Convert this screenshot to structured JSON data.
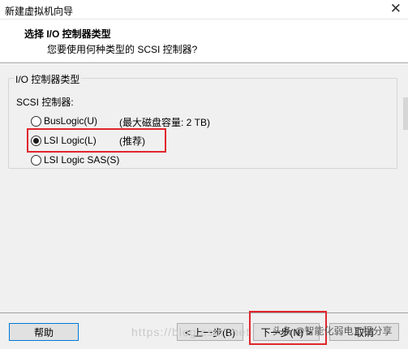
{
  "window": {
    "title": "新建虚拟机向导",
    "close_glyph": "✕"
  },
  "header": {
    "title": "选择 I/O 控制器类型",
    "subtitle": "您要使用何种类型的 SCSI 控制器?"
  },
  "group": {
    "legend": "I/O 控制器类型",
    "scsi_label": "SCSI 控制器:",
    "options": [
      {
        "label": "BusLogic(U)",
        "note": "(最大磁盘容量: 2 TB)",
        "selected": false
      },
      {
        "label": "LSI Logic(L)",
        "note": "(推荐)",
        "selected": true
      },
      {
        "label": "LSI Logic SAS(S)",
        "note": "",
        "selected": false
      }
    ]
  },
  "footer": {
    "help": "帮助",
    "back": "< 上一步(B)",
    "next": "下一步(N) >",
    "cancel": "取消"
  },
  "watermark": {
    "url": "https://blog.csdn.net",
    "author": "头条 @智能化弱电工程分享"
  },
  "colors": {
    "highlight": "#e0262c",
    "panel": "#f0f0f0",
    "primary_border": "#0078d7"
  }
}
